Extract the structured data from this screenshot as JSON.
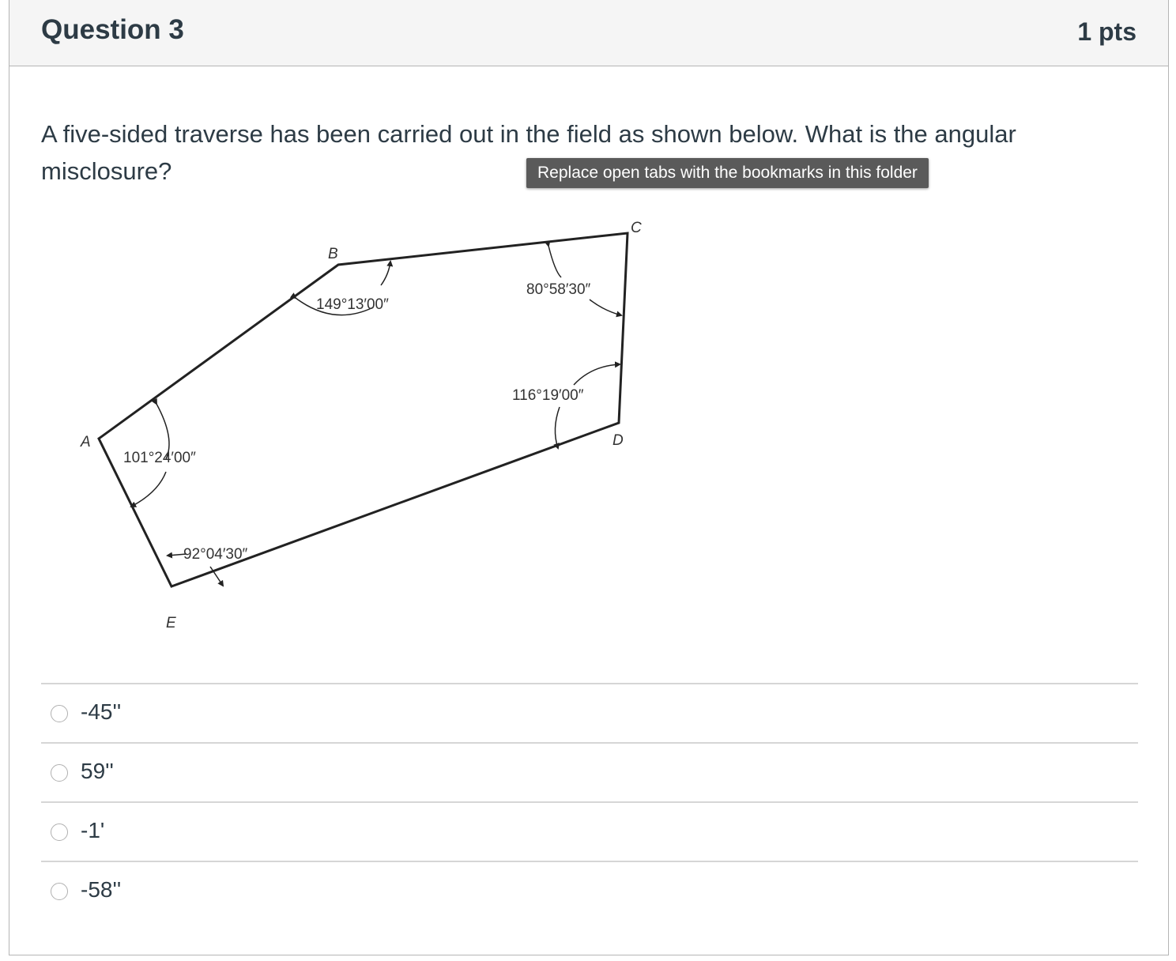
{
  "question": {
    "title": "Question 3",
    "points": "1 pts",
    "text": "A five-sided traverse has been carried out in the field as shown below. What is the angular misclosure?"
  },
  "tooltip": "Replace open tabs with the bookmarks in this folder",
  "diagram": {
    "vertices": {
      "a": "A",
      "b": "B",
      "c": "C",
      "d": "D",
      "e": "E"
    },
    "angles": {
      "a": "101°24′00″",
      "b": "149°13′00″",
      "c": "80°58′30″",
      "d": "116°19′00″",
      "e": "92°04′30″"
    }
  },
  "answers": [
    "-45''",
    "59''",
    "-1'",
    "-58''"
  ],
  "colors": {
    "text": "#2d3b45",
    "header_bg": "#f5f5f5",
    "border": "#b5b5b5",
    "tooltip_bg": "#5a5a5a"
  }
}
